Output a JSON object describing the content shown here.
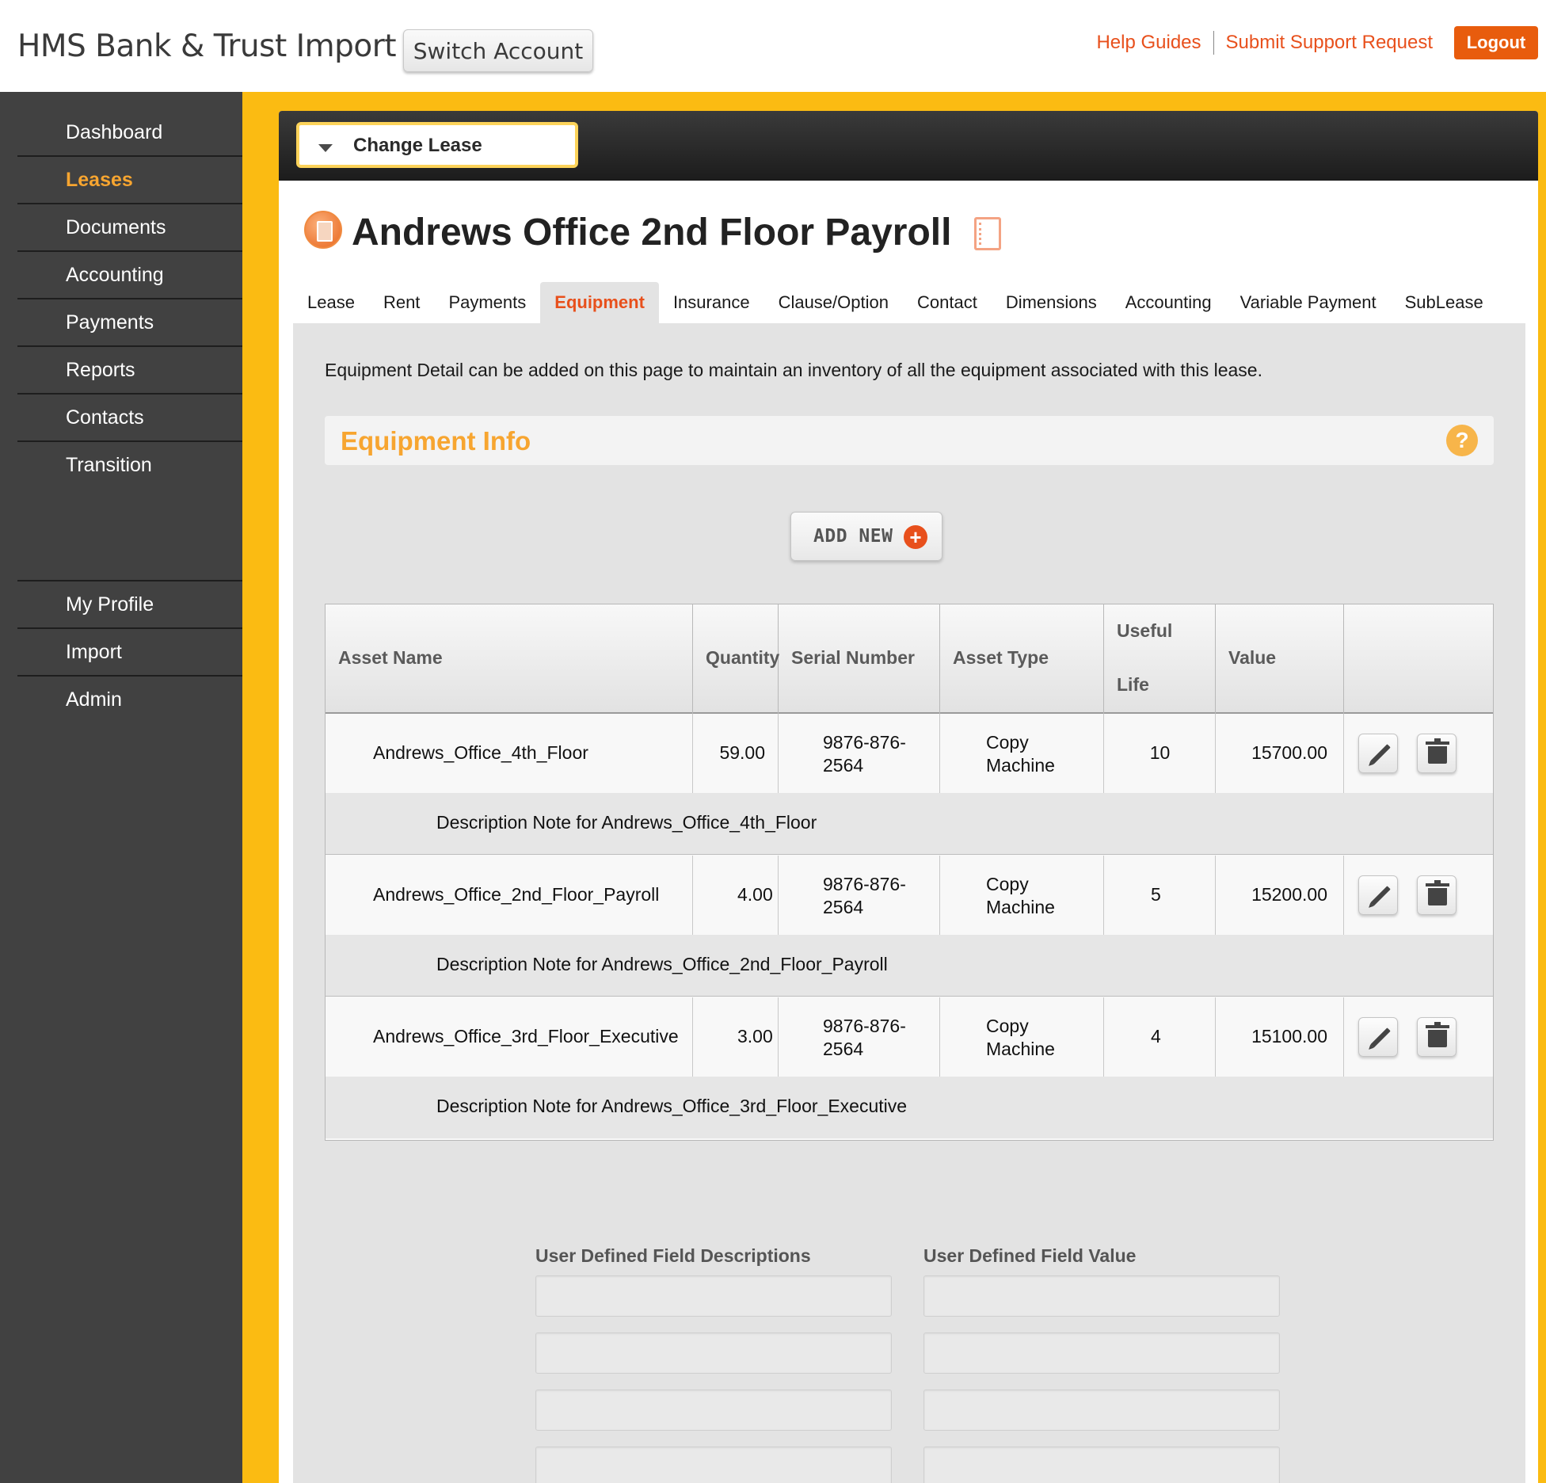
{
  "header": {
    "app_title": "HMS Bank & Trust Import",
    "switch_account_label": "Switch Account",
    "help_guides_label": "Help Guides",
    "support_label": "Submit Support Request",
    "logout_label": "Logout"
  },
  "sidebar": {
    "items": [
      {
        "label": "Dashboard"
      },
      {
        "label": "Leases"
      },
      {
        "label": "Documents"
      },
      {
        "label": "Accounting"
      },
      {
        "label": "Payments"
      },
      {
        "label": "Reports"
      },
      {
        "label": "Contacts"
      },
      {
        "label": "Transition"
      }
    ],
    "bottom_items": [
      {
        "label": "My Profile"
      },
      {
        "label": "Import"
      },
      {
        "label": "Admin"
      }
    ],
    "active": "Leases"
  },
  "lease": {
    "change_lease_label": "Change Lease",
    "title": "Andrews Office 2nd Floor Payroll"
  },
  "tabs": [
    {
      "label": "Lease"
    },
    {
      "label": "Rent"
    },
    {
      "label": "Payments"
    },
    {
      "label": "Equipment"
    },
    {
      "label": "Insurance"
    },
    {
      "label": "Clause/Option"
    },
    {
      "label": "Contact"
    },
    {
      "label": "Dimensions"
    },
    {
      "label": "Accounting"
    },
    {
      "label": "Variable Payment"
    },
    {
      "label": "SubLease"
    }
  ],
  "active_tab": "Equipment",
  "equipment": {
    "intro": "Equipment Detail can be added on this page to maintain an inventory of all the equipment associated with this lease.",
    "section_title": "Equipment Info",
    "help_symbol": "?",
    "add_new_label": "ADD NEW",
    "add_new_symbol": "+",
    "columns": {
      "asset_name": "Asset Name",
      "quantity": "Quantity",
      "serial_number": "Serial Number",
      "asset_type": "Asset Type",
      "useful_life_1": "Useful",
      "useful_life_2": "Life",
      "value": "Value"
    },
    "rows": [
      {
        "asset_name": "Andrews_Office_4th_Floor",
        "quantity": "59.00",
        "serial_1": "9876-876-",
        "serial_2": "2564",
        "type_1": "Copy",
        "type_2": "Machine",
        "useful_life": "10",
        "value": "15700.00",
        "description": "Description Note for Andrews_Office_4th_Floor"
      },
      {
        "asset_name": "Andrews_Office_2nd_Floor_Payroll",
        "quantity": "4.00",
        "serial_1": "9876-876-",
        "serial_2": "2564",
        "type_1": "Copy",
        "type_2": "Machine",
        "useful_life": "5",
        "value": "15200.00",
        "description": "Description Note for Andrews_Office_2nd_Floor_Payroll"
      },
      {
        "asset_name": "Andrews_Office_3rd_Floor_Executive",
        "quantity": "3.00",
        "serial_1": "9876-876-",
        "serial_2": "2564",
        "type_1": "Copy",
        "type_2": "Machine",
        "useful_life": "4",
        "value": "15100.00",
        "description": "Description Note for Andrews_Office_3rd_Floor_Executive"
      }
    ]
  },
  "udf": {
    "descriptions_label": "User Defined Field Descriptions",
    "value_label": "User Defined Field Value"
  },
  "colors": {
    "accent_orange": "#e8501c",
    "highlight_orange": "#f7a530",
    "frame_yellow": "#fbbb12",
    "sidebar_bg": "#414141"
  },
  "icons": [
    "caret-down-icon",
    "lease-icon",
    "notebook-icon",
    "help-icon",
    "plus-icon",
    "edit-icon",
    "trash-icon"
  ]
}
